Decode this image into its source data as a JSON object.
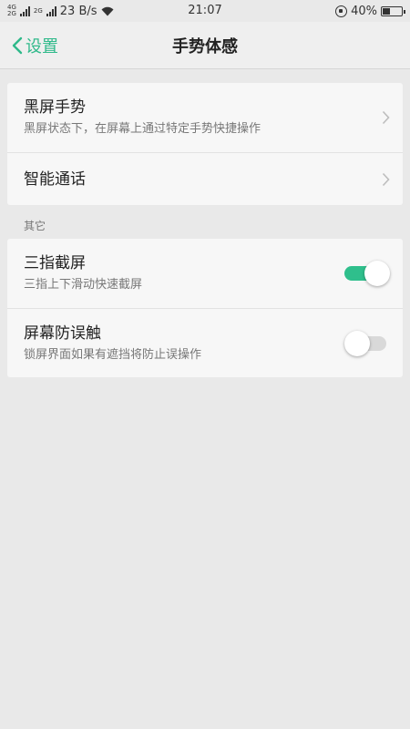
{
  "status_bar": {
    "network_top": "4G",
    "network_bottom": "2G",
    "network2": "2G",
    "speed": "23 B/s",
    "time": "21:07",
    "battery_percent": "40%",
    "battery_level": 0.4
  },
  "header": {
    "back_label": "设置",
    "title": "手势体感"
  },
  "group1": {
    "items": [
      {
        "title": "黑屏手势",
        "subtitle": "黑屏状态下，在屏幕上通过特定手势快捷操作"
      },
      {
        "title": "智能通话"
      }
    ]
  },
  "section_label": "其它",
  "group2": {
    "items": [
      {
        "title": "三指截屏",
        "subtitle": "三指上下滑动快速截屏",
        "enabled": true
      },
      {
        "title": "屏幕防误触",
        "subtitle": "锁屏界面如果有遮挡将防止误操作",
        "enabled": false
      }
    ]
  },
  "colors": {
    "accent": "#2fbf8c",
    "back_link": "#2fb98a",
    "background": "#e9e9e9"
  },
  "icons": {
    "back": "chevron-left-icon",
    "row_arrow": "chevron-right-icon"
  }
}
